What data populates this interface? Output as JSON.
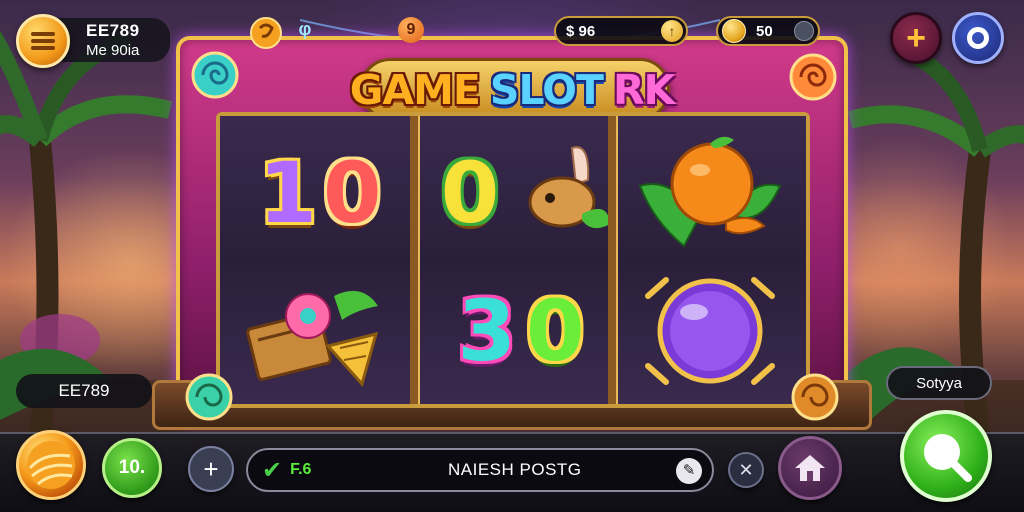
{
  "player": {
    "name": "EE789",
    "subtitle": "Me 90ia"
  },
  "top_bar": {
    "gem_badge_label": "9",
    "gem_small_label": "φ",
    "cash_label": "$ 96",
    "coins_label": "50"
  },
  "machine": {
    "title_part1": "GAME",
    "title_part2": "SLOT",
    "title_part3": "RK",
    "reels": [
      {
        "top": "10",
        "bottom": "crate-flower-cone"
      },
      {
        "top": "0",
        "bottom": "30"
      },
      {
        "top": "orange",
        "bottom": "purple-orb"
      }
    ],
    "reel1_top_text_a": "1",
    "reel1_top_text_b": "0",
    "reel2_top_text": "0",
    "reel2_bottom_text_a": "3",
    "reel2_bottom_text_b": "0"
  },
  "side_labels": {
    "left": "EE789",
    "right": "Sotyya"
  },
  "bottom_bar": {
    "bet_label": "10.",
    "win_label": "F.6",
    "message": "NAIESH POSTG"
  },
  "colors": {
    "frame_pink": "#d13a8a",
    "gold_trim": "#f1c14a",
    "spin_green": "#2fb01a",
    "reel_bg": "#2a1e3a"
  },
  "icons": {
    "menu": "hamburger-icon",
    "cash": "cash-icon",
    "coin": "coin-icon",
    "plus": "plus-icon",
    "profile": "ring-icon",
    "orb": "fire-orb-icon",
    "add": "plus-icon",
    "check": "check-icon",
    "edit": "pencil-icon",
    "close": "close-icon",
    "home": "home-icon",
    "spin": "search-icon"
  }
}
